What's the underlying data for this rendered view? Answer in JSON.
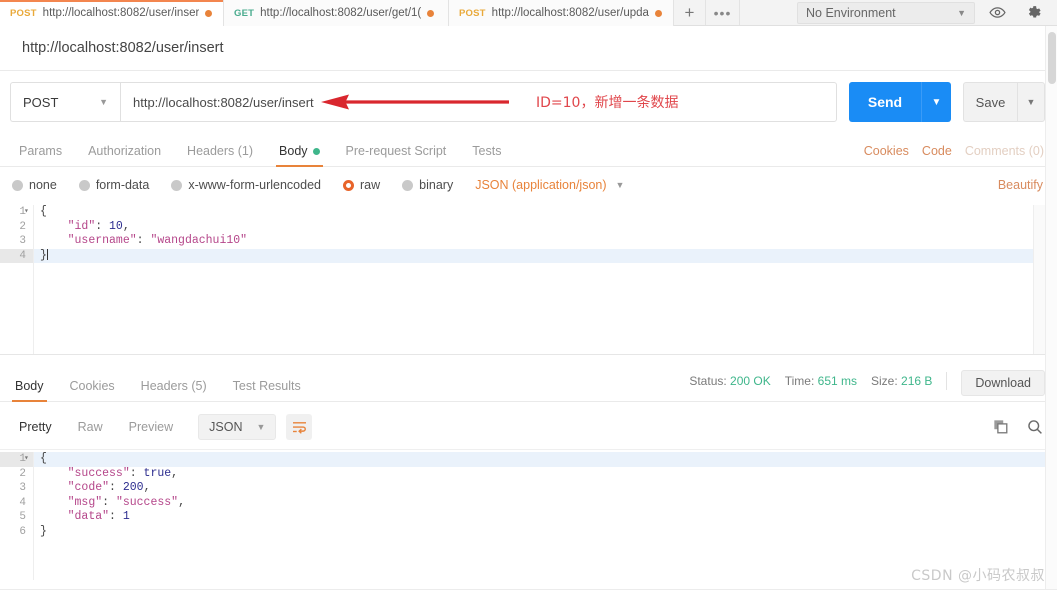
{
  "tabbar": {
    "tabs": [
      {
        "method": "POST",
        "url": "http://localhost:8082/user/inser",
        "active": true
      },
      {
        "method": "GET",
        "url": "http://localhost:8082/user/get/1(",
        "active": false
      },
      {
        "method": "POST",
        "url": "http://localhost:8082/user/upda",
        "active": false
      }
    ],
    "new_tab_label": "+",
    "more_label": "•••",
    "environment": "No Environment",
    "environment_caret": "▼",
    "eye_icon": "eye-icon",
    "gear_icon": "gear-icon"
  },
  "request": {
    "name": "http://localhost:8082/user/insert",
    "method": "POST",
    "method_caret": "▼",
    "url": "http://localhost:8082/user/insert",
    "annotation": "ID=10，新增一条数据",
    "send_label": "Send",
    "send_caret": "▼",
    "save_label": "Save",
    "save_caret": "▼",
    "tabs": [
      {
        "label": "Params",
        "active": false,
        "dot": false
      },
      {
        "label": "Authorization",
        "active": false,
        "dot": false
      },
      {
        "label": "Headers (1)",
        "active": false,
        "dot": false
      },
      {
        "label": "Body",
        "active": true,
        "dot": true
      },
      {
        "label": "Pre-request Script",
        "active": false,
        "dot": false
      },
      {
        "label": "Tests",
        "active": false,
        "dot": false
      }
    ],
    "links": {
      "cookies": "Cookies",
      "code": "Code",
      "comments": "Comments (0)"
    },
    "body_types": [
      {
        "label": "none",
        "selected": false
      },
      {
        "label": "form-data",
        "selected": false
      },
      {
        "label": "x-www-form-urlencoded",
        "selected": false
      },
      {
        "label": "raw",
        "selected": true
      },
      {
        "label": "binary",
        "selected": false
      }
    ],
    "format": "JSON (application/json)",
    "format_caret": "▼",
    "beautify_label": "Beautify",
    "body_lines": [
      {
        "n": "1",
        "fold": true,
        "text": "{"
      },
      {
        "n": "2",
        "fold": false,
        "text": "    \"id\": 10,"
      },
      {
        "n": "3",
        "fold": false,
        "text": "    \"username\": \"wangdachui10\""
      },
      {
        "n": "4",
        "fold": false,
        "text": "}"
      }
    ]
  },
  "response": {
    "tabs": [
      {
        "label": "Body",
        "active": true
      },
      {
        "label": "Cookies",
        "active": false
      },
      {
        "label": "Headers (5)",
        "active": false
      },
      {
        "label": "Test Results",
        "active": false
      }
    ],
    "status_label": "Status:",
    "status_value": "200 OK",
    "time_label": "Time:",
    "time_value": "651 ms",
    "size_label": "Size:",
    "size_value": "216 B",
    "download_label": "Download",
    "view_tabs": [
      {
        "label": "Pretty",
        "active": true
      },
      {
        "label": "Raw",
        "active": false
      },
      {
        "label": "Preview",
        "active": false
      }
    ],
    "format": "JSON",
    "format_caret": "▼",
    "wrap_icon": "word-wrap-icon",
    "copy_icon": "copy-icon",
    "search_icon": "search-icon",
    "body_lines": [
      {
        "n": "1",
        "fold": true,
        "text": "{"
      },
      {
        "n": "2",
        "fold": false,
        "text": "    \"success\": true,"
      },
      {
        "n": "3",
        "fold": false,
        "text": "    \"code\": 200,"
      },
      {
        "n": "4",
        "fold": false,
        "text": "    \"msg\": \"success\","
      },
      {
        "n": "5",
        "fold": false,
        "text": "    \"data\": 1"
      },
      {
        "n": "6",
        "fold": false,
        "text": "}"
      }
    ]
  },
  "watermark": "CSDN @小码农叔叔",
  "colors": {
    "accent_orange": "#e8833a",
    "send_blue": "#1a8cf5",
    "status_green": "#3fb68b",
    "annotation_red": "#e0464b",
    "post_yellow": "#e9a93a",
    "get_green": "#4aab8e"
  }
}
